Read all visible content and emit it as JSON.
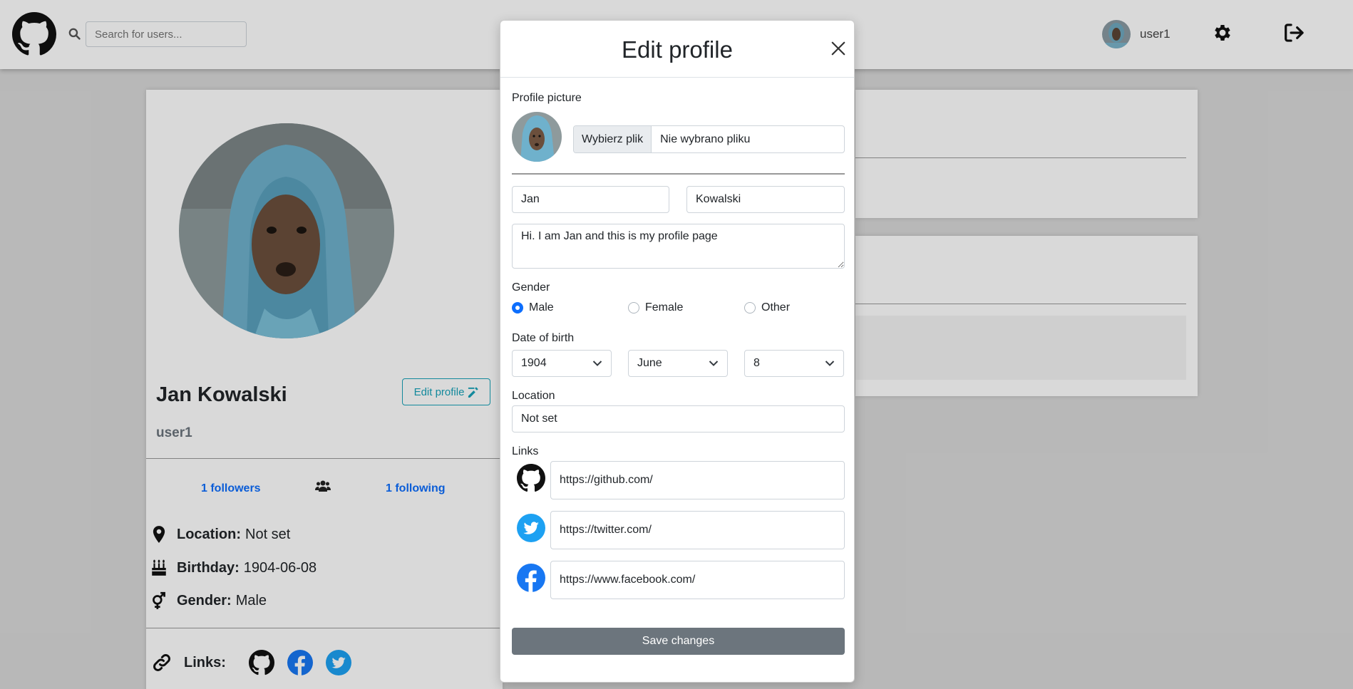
{
  "topbar": {
    "search_placeholder": "Search for users...",
    "username": "user1"
  },
  "profile": {
    "full_name": "Jan Kowalski",
    "edit_button": "Edit profile",
    "username": "user1",
    "followers": "1 followers",
    "following": "1 following",
    "location_label": "Location:",
    "location_value": "Not set",
    "birthday_label": "Birthday:",
    "birthday_value": "1904-06-08",
    "gender_label": "Gender:",
    "gender_value": "Male",
    "links_label": "Links:"
  },
  "modal": {
    "title": "Edit profile",
    "picture_label": "Profile picture",
    "file_button": "Wybierz plik",
    "file_status": "Nie wybrano pliku",
    "first_name": "Jan",
    "last_name": "Kowalski",
    "bio": "Hi. I am Jan and this is my profile page",
    "gender_label": "Gender",
    "gender_options": [
      "Male",
      "Female",
      "Other"
    ],
    "gender_selected": "Male",
    "dob_label": "Date of birth",
    "dob_year": "1904",
    "dob_month": "June",
    "dob_day": "8",
    "location_label": "Location",
    "location_value": "Not set",
    "links_label": "Links",
    "links": {
      "github": "https://github.com/",
      "twitter": "https://twitter.com/",
      "facebook": "https://www.facebook.com/"
    },
    "save_button": "Save changes"
  },
  "colors": {
    "primary": "#0d6efd",
    "info": "#17a2b8",
    "secondary": "#6c757d",
    "twitter": "#1da1f2",
    "facebook": "#1877f2"
  },
  "icons": [
    "github-logo-icon",
    "search-icon",
    "gear-icon",
    "logout-icon",
    "edit-icon",
    "users-icon",
    "map-pin-icon",
    "cake-icon",
    "gender-icon",
    "link-icon",
    "github-icon",
    "facebook-icon",
    "twitter-icon",
    "close-icon",
    "chevron-down-icon"
  ]
}
